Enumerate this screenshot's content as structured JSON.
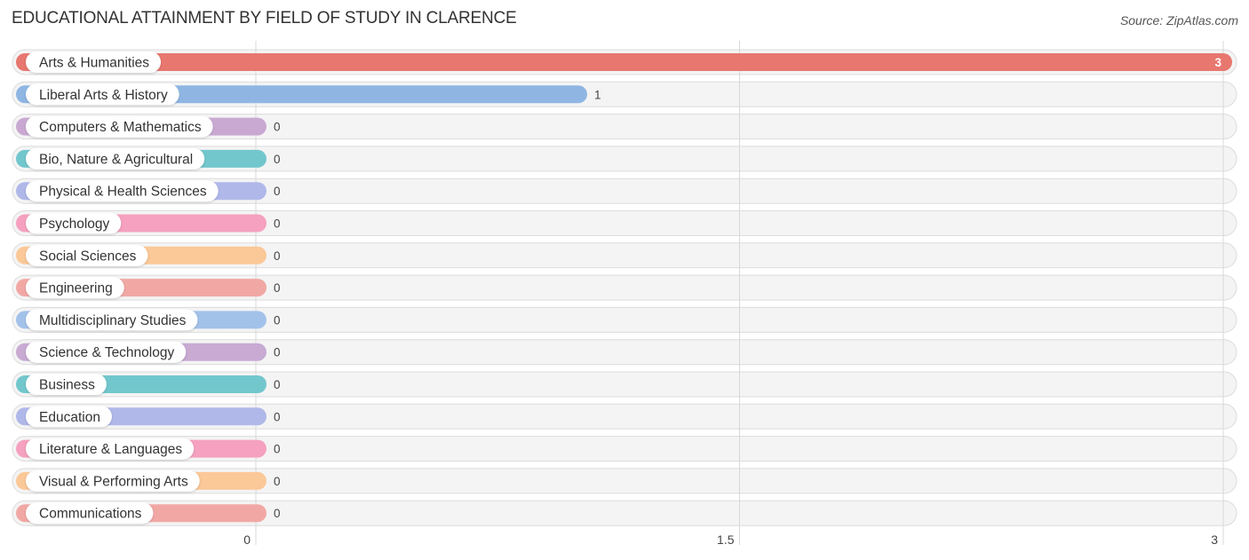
{
  "chart_data": {
    "type": "bar",
    "orientation": "horizontal",
    "title": "EDUCATIONAL ATTAINMENT BY FIELD OF STUDY IN CLARENCE",
    "source": "Source: ZipAtlas.com",
    "xlabel": "",
    "ylabel": "",
    "xlim": [
      0,
      3
    ],
    "xticks": [
      {
        "value": 0,
        "label": "0"
      },
      {
        "value": 1.5,
        "label": "1.5"
      },
      {
        "value": 3,
        "label": "3"
      }
    ],
    "grid": true,
    "categories": [
      "Arts & Humanities",
      "Liberal Arts & History",
      "Computers & Mathematics",
      "Bio, Nature & Agricultural",
      "Physical & Health Sciences",
      "Psychology",
      "Social Sciences",
      "Engineering",
      "Multidisciplinary Studies",
      "Science & Technology",
      "Business",
      "Education",
      "Literature & Languages",
      "Visual & Performing Arts",
      "Communications"
    ],
    "values": [
      3,
      1,
      0,
      0,
      0,
      0,
      0,
      0,
      0,
      0,
      0,
      0,
      0,
      0,
      0
    ],
    "value_labels": [
      "3",
      "1",
      "0",
      "0",
      "0",
      "0",
      "0",
      "0",
      "0",
      "0",
      "0",
      "0",
      "0",
      "0",
      "0"
    ],
    "colors": [
      "#e8776f",
      "#8fb6e3",
      "#c9a9d2",
      "#72c7cd",
      "#b0b8ea",
      "#f5a1bf",
      "#fbc898",
      "#f1a8a5",
      "#a3c2ea",
      "#c8aad3",
      "#72c7cd",
      "#b0b8ea",
      "#f5a1bf",
      "#fbc898",
      "#f1a8a5"
    ]
  }
}
